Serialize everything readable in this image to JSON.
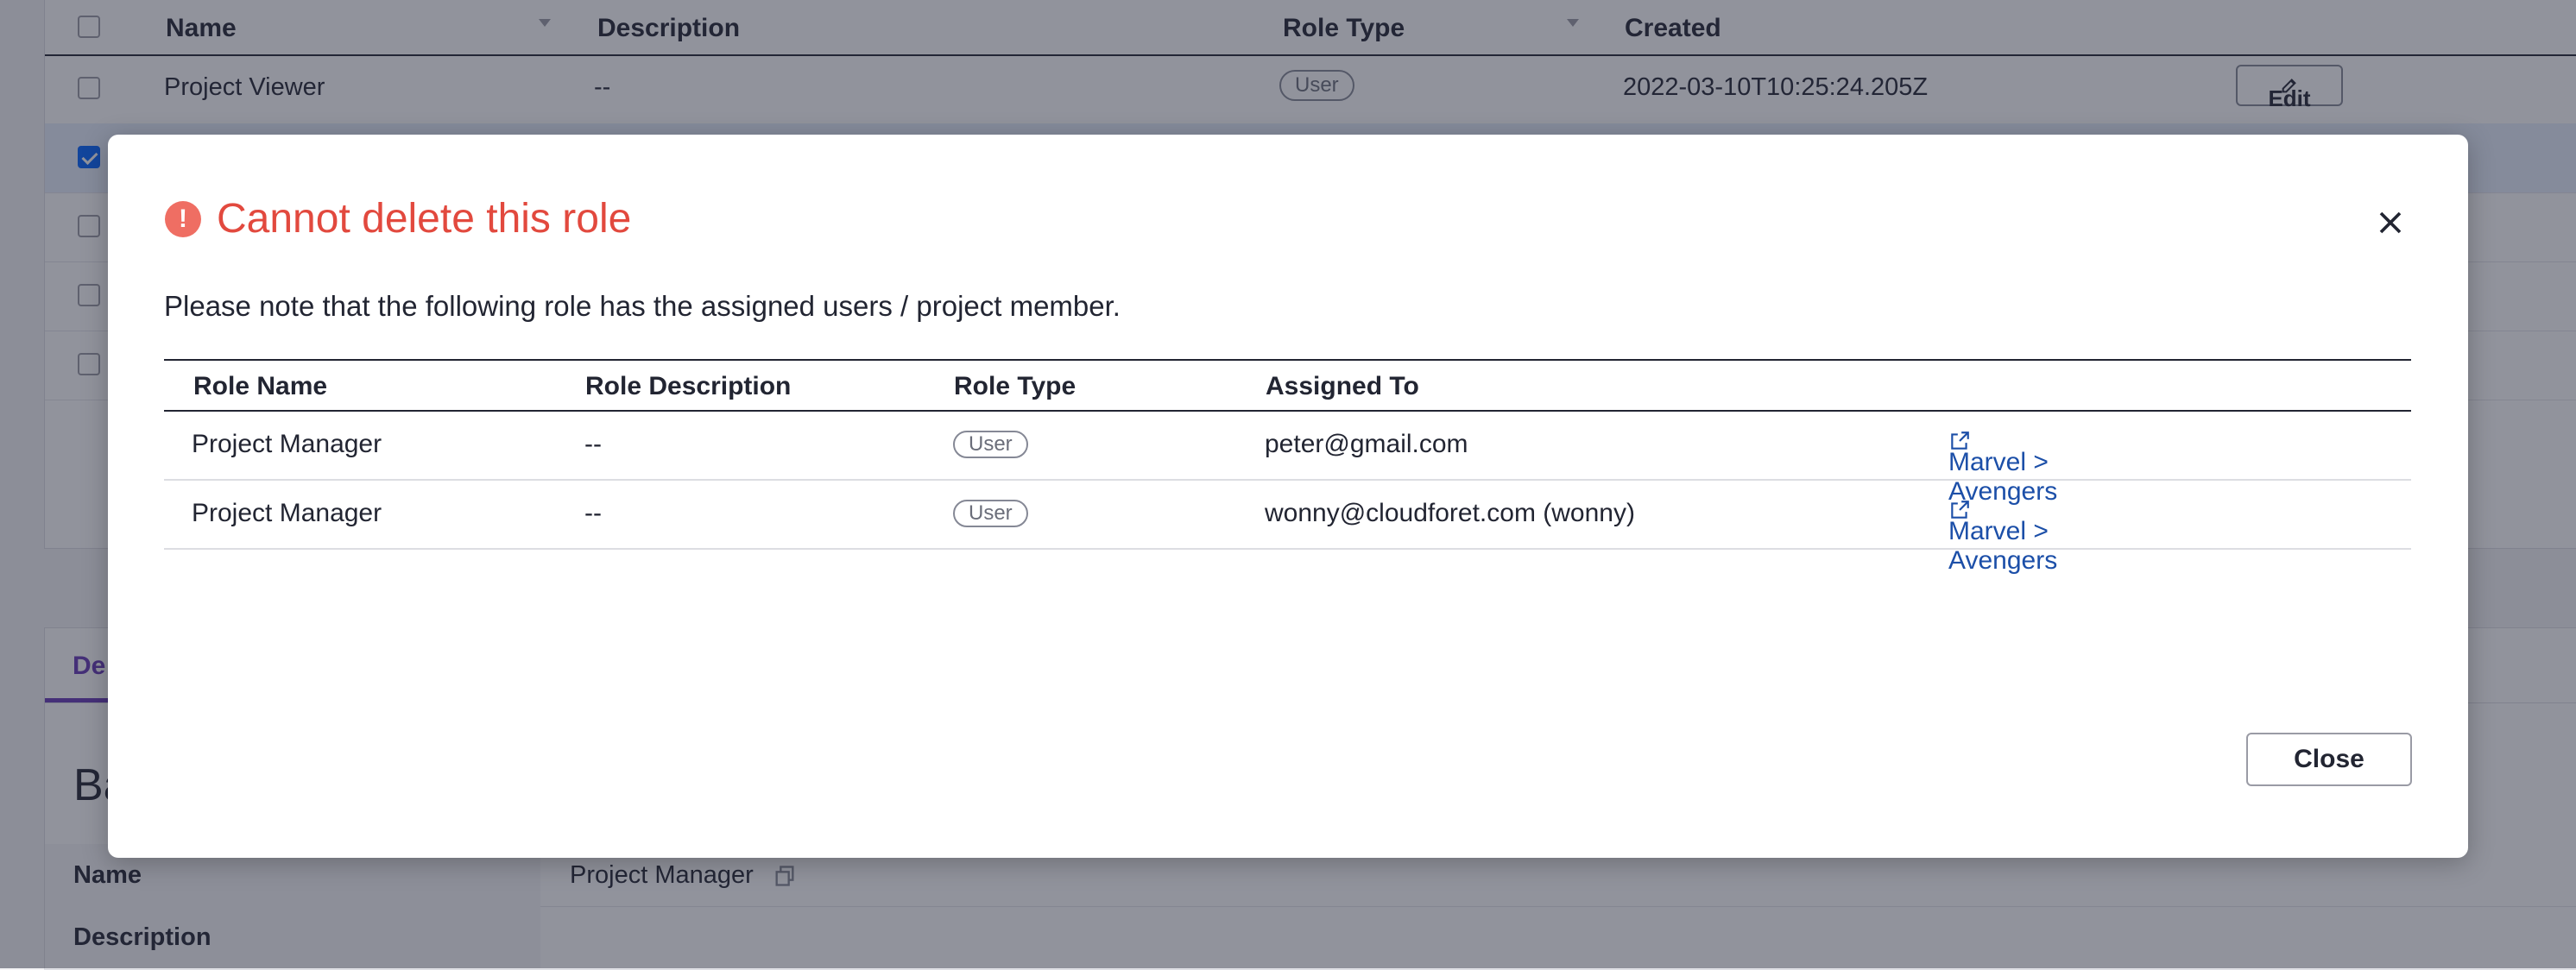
{
  "background_table": {
    "columns": [
      "Name",
      "Description",
      "Role Type",
      "Created"
    ],
    "rows": [
      {
        "name": "Project Viewer",
        "description": "--",
        "role_type": "User",
        "created": "2022-03-10T10:25:24.205Z",
        "edit_label": "Edit"
      }
    ]
  },
  "background_detail": {
    "tab_label": "De",
    "section_title": "Ba",
    "fields": [
      {
        "key": "Name",
        "value": "Project Manager"
      },
      {
        "key": "Description",
        "value": ""
      }
    ]
  },
  "modal": {
    "title": "Cannot delete this role",
    "note": "Please note that the following role has the assigned users / project member.",
    "columns": [
      "Role Name",
      "Role Description",
      "Role Type",
      "Assigned To",
      ""
    ],
    "rows": [
      {
        "role_name": "Project Manager",
        "role_description": "--",
        "role_type": "User",
        "assigned_to": "peter@gmail.com",
        "project": "Marvel > Avengers"
      },
      {
        "role_name": "Project Manager",
        "role_description": "--",
        "role_type": "User",
        "assigned_to": "wonny@cloudforet.com (wonny)",
        "project": "Marvel > Avengers"
      }
    ],
    "close_label": "Close"
  },
  "colors": {
    "alert": "#e2493e",
    "link": "#1c4fa8",
    "accent": "#6638b6",
    "checkbox": "#0062ff"
  },
  "icons": [
    "alert-circle-icon",
    "close-icon",
    "external-link-icon",
    "edit-icon",
    "copy-icon",
    "sort-icon"
  ]
}
